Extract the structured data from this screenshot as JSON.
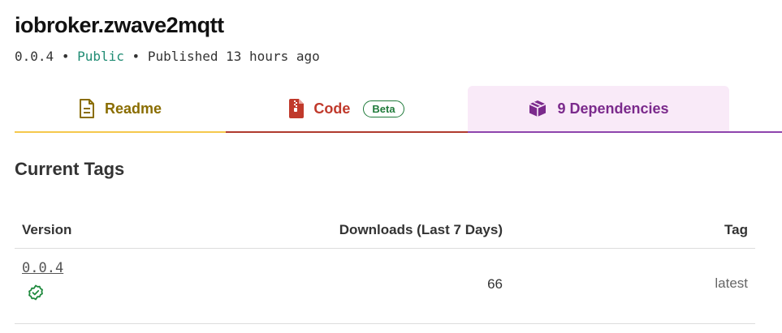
{
  "package": {
    "name": "iobroker.zwave2mqtt",
    "version": "0.0.4",
    "separator": "•",
    "visibility": "Public",
    "published": "Published 13 hours ago"
  },
  "tabs": [
    {
      "label": "Readme",
      "icon": "document-icon",
      "color": "#8a6d00"
    },
    {
      "label": "Code",
      "icon": "zip-file-icon",
      "badge": "Beta",
      "color": "#c0392b"
    },
    {
      "label": "9 Dependencies",
      "icon": "box-icon",
      "color": "#7b2a8c",
      "active": true
    }
  ],
  "current_tags": {
    "title": "Current Tags",
    "headers": {
      "version": "Version",
      "downloads": "Downloads (Last 7 Days)",
      "tag": "Tag"
    },
    "rows": [
      {
        "version": "0.0.4",
        "verified_icon": "check-circle-icon",
        "downloads": "66",
        "tag": "latest"
      }
    ]
  }
}
